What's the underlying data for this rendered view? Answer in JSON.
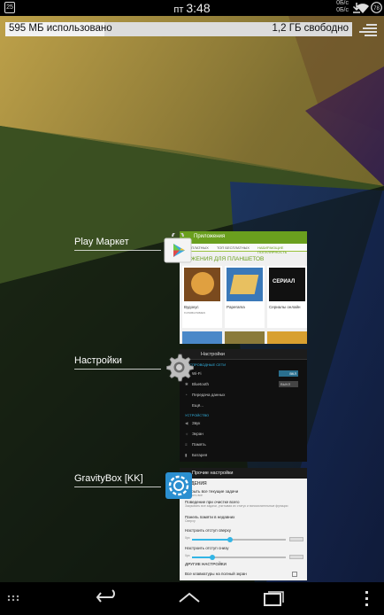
{
  "status_bar": {
    "calendar_day": "25",
    "day": "пт",
    "time": "3:48",
    "net_up": "0Б/с",
    "net_down": "0Б/с",
    "battery": "78",
    "icons": [
      "calendar-icon",
      "wifi-icon",
      "download-icon",
      "battery-icon"
    ]
  },
  "memory": {
    "used_text": "595 МБ использовано",
    "free_text": "1,2 ГБ свободно"
  },
  "recent_apps": [
    {
      "name": "Play Маркет",
      "thumb": {
        "header": "Приложения",
        "tabs": [
          "ТОП ПЛАТНЫХ",
          "ТОП БЕСПЛАТНЫХ",
          "НАБИРАЮЩИЕ ПОПУЛЯРНОСТЬ"
        ],
        "section": "РЕЖЕНИЯ ДЛЯ ПЛАНШЕТОВ",
        "cards": [
          {
            "title": "Вудокус",
            "sub": "головоломка"
          },
          {
            "title": "Paperama",
            "sub": ""
          },
          {
            "title": "Сериалы онлайн",
            "sub": ""
          }
        ],
        "card_badge": "СЕРИАЛ"
      }
    },
    {
      "name": "Настройки",
      "thumb": {
        "header": "Настройки",
        "section_wireless": "БЕСПРОВОДНЫЕ СЕТИ",
        "rows": [
          "Wi-Fi",
          "Bluetooth",
          "Передача данных",
          "Ещё..."
        ],
        "toggles": [
          "ВКЛ",
          "ВЫКЛ"
        ],
        "section_device": "УСТРОЙСТВО",
        "device_rows": [
          "Звук",
          "Экран",
          "Память",
          "Батарея"
        ]
      }
    },
    {
      "name": "GravityBox [KK]",
      "thumb": {
        "header": "Прочие настройки",
        "section": "ВЕДЕНИЯ",
        "rows": [
          {
            "title": "Закрыть все текущие задачи",
            "sub": "Закрыть все"
          },
          {
            "title": "Поведение при очистке всего",
            "sub": "Закрывать все задачи, учитывая их статус и вспомогательные функции"
          },
          {
            "title": "Панель памяти в недавних",
            "sub": "Сверху"
          },
          {
            "title": "Настроить отступ сверху",
            "sub": "0px"
          },
          {
            "title": "Настроить отступ снизу",
            "sub": "0px"
          }
        ],
        "slider_values": [
          0,
          0
        ],
        "section2": "ДРУГИЕ НАСТРОЙКИ",
        "last_row": "Все клавиатуры на полный экран"
      }
    }
  ],
  "nav_bar": {
    "items": [
      "back-icon",
      "home-icon",
      "recents-icon",
      "menu-icon"
    ]
  },
  "colors": {
    "accent_green": "#96c31c",
    "settings_blue": "#33b5e5",
    "gravity_blue": "#2b8fd0"
  }
}
